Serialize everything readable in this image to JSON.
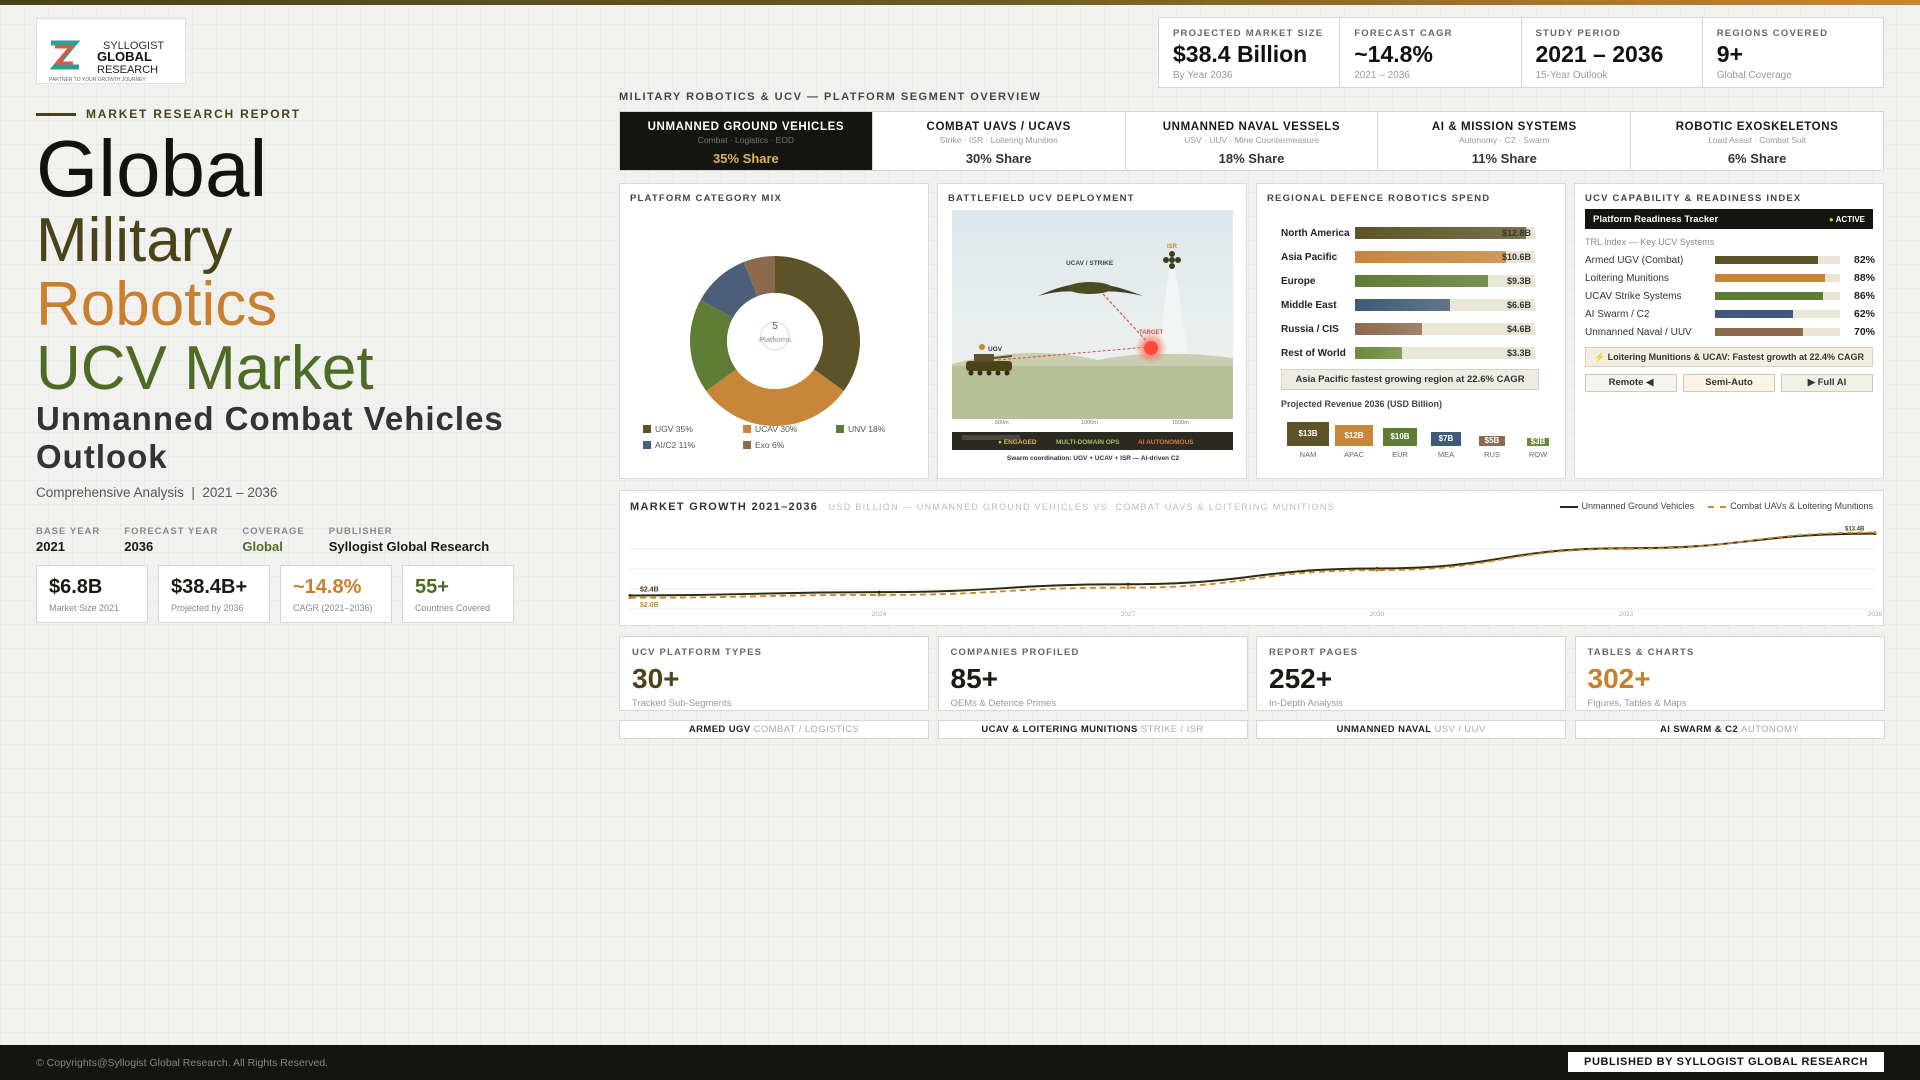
{
  "logo": {
    "line1": "SYLLOGIST",
    "line2": "GLOBAL",
    "line3": "RESEARCH",
    "tagline": "PARTNER TO YOUR GROWTH JOURNEY"
  },
  "left": {
    "tag": "MARKET RESEARCH REPORT",
    "title_lines": [
      "Global",
      "Military",
      "Robotics",
      "UCV Market"
    ],
    "subtitle": "Unmanned Combat Vehicles Outlook",
    "analysis": "Comprehensive Analysis  |  2021 – 2036",
    "meta": [
      {
        "k": "BASE YEAR",
        "v": "2021"
      },
      {
        "k": "FORECAST YEAR",
        "v": "2036"
      },
      {
        "k": "COVERAGE",
        "v": "Global"
      },
      {
        "k": "PUBLISHER",
        "v": "Syllogist Global Research"
      }
    ],
    "stats": [
      {
        "v": "$6.8B",
        "c": "Market Size 2021",
        "color": "#1a1a14"
      },
      {
        "v": "$38.4B+",
        "c": "Projected by 2036",
        "color": "#1a1a14"
      },
      {
        "v": "~14.8%",
        "c": "CAGR (2021–2036)",
        "color": "#c8802f"
      },
      {
        "v": "55+",
        "c": "Countries Covered",
        "color": "#4d6b24"
      }
    ]
  },
  "top_stats": [
    {
      "k": "PROJECTED MARKET SIZE",
      "v": "$38.4 Billion",
      "c": "By Year 2036"
    },
    {
      "k": "FORECAST CAGR",
      "v": "~14.8%",
      "c": "2021 – 2036"
    },
    {
      "k": "STUDY PERIOD",
      "v": "2021 – 2036",
      "c": "15-Year Outlook"
    },
    {
      "k": "REGIONS COVERED",
      "v": "9+",
      "c": "Global Coverage"
    }
  ],
  "segment_title": "MILITARY ROBOTICS & UCV — PLATFORM SEGMENT OVERVIEW",
  "tabs": [
    {
      "n": "UNMANNED GROUND VEHICLES",
      "s": "Combat · Logistics · EOD",
      "p": "35% Share"
    },
    {
      "n": "COMBAT UAVS / UCAVS",
      "s": "Strike · ISR · Loitering Munition",
      "p": "30% Share"
    },
    {
      "n": "UNMANNED NAVAL VESSELS",
      "s": "USV · UUV · Mine Countermeasure",
      "p": "18% Share"
    },
    {
      "n": "AI & MISSION SYSTEMS",
      "s": "Autonomy · C2 · Swarm",
      "p": "11% Share"
    },
    {
      "n": "ROBOTIC EXOSKELETONS",
      "s": "Load Assist · Combat Suit",
      "p": "6% Share"
    }
  ],
  "platform_mix": {
    "title": "PLATFORM CATEGORY MIX",
    "center_value": "5",
    "center_label": "Platforms",
    "legend": [
      {
        "name": "UGV 35%",
        "color": "#5c5428"
      },
      {
        "name": "UCAV 30%",
        "color": "#c8863a"
      },
      {
        "name": "UNV 18%",
        "color": "#5d7c34"
      },
      {
        "name": "AI/C2 11%",
        "color": "#4b6078"
      },
      {
        "name": "Exo 6%",
        "color": "#8c6a4e"
      }
    ]
  },
  "battlefield": {
    "title": "BATTLEFIELD UCV DEPLOYMENT",
    "ucav": "UCAV / STRIKE",
    "isr": "ISR",
    "target": "TARGET",
    "ugv": "UGV",
    "ranges": [
      "500m",
      "1000m",
      "1500m"
    ],
    "status": [
      "● ENGAGED",
      "MULTI-DOMAIN OPS",
      "AI AUTONOMOUS"
    ],
    "caption": "Swarm coordination: UGV + UCAV + ISR — AI-driven C2"
  },
  "regional": {
    "title": "REGIONAL DEFENCE ROBOTICS SPEND",
    "rows": [
      {
        "name": "North America",
        "val": "$12.8B",
        "pct": 0.95,
        "color": "#5c5428"
      },
      {
        "name": "Asia Pacific",
        "val": "$10.6B",
        "pct": 0.84,
        "color": "#c8863a"
      },
      {
        "name": "Europe",
        "val": "$9.3B",
        "pct": 0.74,
        "color": "#5d7c34"
      },
      {
        "name": "Middle East",
        "val": "$6.6B",
        "pct": 0.53,
        "color": "#3e5a78"
      },
      {
        "name": "Russia / CIS",
        "val": "$4.6B",
        "pct": 0.37,
        "color": "#8c6a4e"
      },
      {
        "name": "Rest of World",
        "val": "$3.3B",
        "pct": 0.26,
        "color": "#6b8a3a"
      }
    ],
    "note": "Asia Pacific fastest growing region at 22.6% CAGR",
    "proj_title": "Projected Revenue 2036 (USD Billion)",
    "proj": [
      {
        "label": "NAM",
        "val": "$13B",
        "h": 24,
        "color": "#5c5428"
      },
      {
        "label": "APAC",
        "val": "$12B",
        "h": 21,
        "color": "#c8863a"
      },
      {
        "label": "EUR",
        "val": "$10B",
        "h": 18,
        "color": "#5d7c34"
      },
      {
        "label": "MEA",
        "val": "$7B",
        "h": 14,
        "color": "#3e5a78"
      },
      {
        "label": "RUS",
        "val": "$5B",
        "h": 10,
        "color": "#8c6a4e"
      },
      {
        "label": "ROW",
        "val": "$3B",
        "h": 8,
        "color": "#6b8a3a"
      }
    ]
  },
  "readiness": {
    "title": "UCV CAPABILITY & READINESS INDEX",
    "tracker": "Platform Readiness Tracker",
    "status": "ACTIVE",
    "subtitle": "TRL Index — Key UCV Systems",
    "rows": [
      {
        "name": "Armed UGV (Combat)",
        "pct": 82,
        "label": "82%",
        "color": "#5c5428"
      },
      {
        "name": "Loitering Munitions",
        "pct": 88,
        "label": "88%",
        "color": "#c8863a"
      },
      {
        "name": "UCAV Strike Systems",
        "pct": 86,
        "label": "86%",
        "color": "#5d7c34"
      },
      {
        "name": "AI Swarm / C2",
        "pct": 62,
        "label": "62%",
        "color": "#3e5a78"
      },
      {
        "name": "Unmanned Naval / UUV",
        "pct": 70,
        "label": "70%",
        "color": "#8c6a4e"
      }
    ],
    "note": "⚡ Loitering Munitions & UCAV: Fastest growth at 22.4% CAGR",
    "buttons": [
      "Remote ◀",
      "Semi-Auto",
      "▶ Full AI"
    ]
  },
  "growth": {
    "title": "MARKET GROWTH 2021–2036",
    "subtitle": "USD BILLION — UNMANNED GROUND VEHICLES VS. COMBAT UAVS & LOITERING MUNITIONS",
    "legend": [
      "Unmanned Ground Vehicles",
      "Combat UAVs & Loitering Munitions"
    ],
    "start_labels": [
      "$2.4B",
      "$2.0B"
    ],
    "end_label": "$13.4B"
  },
  "chart_data": {
    "type": "line",
    "x": [
      2021,
      2024,
      2027,
      2030,
      2033,
      2036
    ],
    "x_tick_labels": [
      "2024",
      "2027",
      "2030",
      "2033",
      "2036"
    ],
    "ylim": [
      0,
      16
    ],
    "series": [
      {
        "name": "Unmanned Ground Vehicles",
        "values": [
          2.4,
          3.0,
          4.4,
          7.2,
          10.8,
          13.4
        ]
      },
      {
        "name": "Combat UAVs & Loitering Munitions",
        "values": [
          2.0,
          2.5,
          3.8,
          6.9,
          10.7,
          13.6
        ]
      }
    ]
  },
  "bottom_stats": [
    {
      "k": "UCV PLATFORM TYPES",
      "v": "30+",
      "c": "Tracked Sub-Segments",
      "color": "#4a4218"
    },
    {
      "k": "COMPANIES PROFILED",
      "v": "85+",
      "c": "OEMs & Defence Primes",
      "color": "#1a1a14"
    },
    {
      "k": "REPORT PAGES",
      "v": "252+",
      "c": "In-Depth Analysis",
      "color": "#1a1a14"
    },
    {
      "k": "TABLES & CHARTS",
      "v": "302+",
      "c": "Figures, Tables & Maps",
      "color": "#c8802f"
    }
  ],
  "chips": [
    {
      "a": "ARMED UGV",
      "b": "COMBAT / LOGISTICS"
    },
    {
      "a": "UCAV & LOITERING MUNITIONS",
      "b": "STRIKE / ISR"
    },
    {
      "a": "UNMANNED NAVAL",
      "b": "USV / UUV"
    },
    {
      "a": "AI SWARM & C2",
      "b": "AUTONOMY"
    }
  ],
  "footer": {
    "copy": "© Copyrights@Syllogist Global Research. All Rights Reserved.",
    "pub": "PUBLISHED BY SYLLOGIST GLOBAL RESEARCH"
  }
}
